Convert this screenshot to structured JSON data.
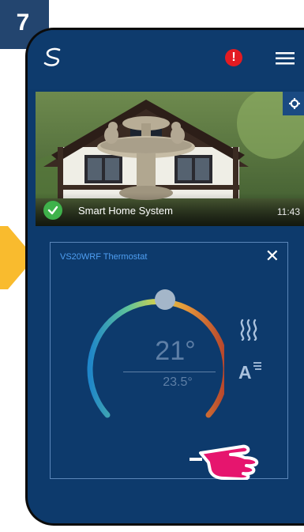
{
  "step": {
    "number": "7"
  },
  "colors": {
    "background": "#0d3a6c",
    "badge": "#23456f",
    "arrow": "#f9bb2e",
    "alert": "#e31b22",
    "hand": "#e6156e",
    "accent_text": "#4f9ff2"
  },
  "header": {
    "logo_icon": "s-logo-icon",
    "alert_badge": "!",
    "menu_icon": "hamburger-menu-icon"
  },
  "camera": {
    "name": "Smart Home System",
    "time": "11:43",
    "status_icon": "check-icon",
    "settings_icon": "gear-icon"
  },
  "thermostat": {
    "title": "VS20WRF Thermostat",
    "set_temp": "21°",
    "current_temp": "23.5°",
    "close_icon": "close-icon",
    "heating_icon": "heat-waves-icon",
    "mode_icon": "auto-mode-icon"
  }
}
